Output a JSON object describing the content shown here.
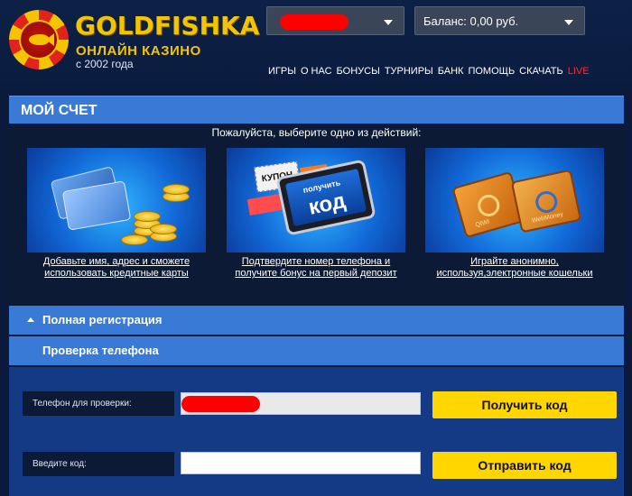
{
  "header": {
    "logo_title": "GOLDFISHKA",
    "logo_subtitle": "ОНЛАЙН КАЗИНО",
    "logo_since": "с 2002 года",
    "user_dropdown_value": "",
    "balance_label": "Баланс: 0,00 руб.",
    "nav": [
      "ИГРЫ",
      "О НАС",
      "БОНУСЫ",
      "ТУРНИРЫ",
      "БАНК",
      "ПОМОЩЬ",
      "СКАЧАТЬ",
      "LIVE"
    ]
  },
  "account": {
    "title": "МОЙ СЧЕТ",
    "prompt": "Пожалуйста, выберите одно из действий:",
    "options": [
      {
        "caption_line1": "Добавьте имя, адрес и сможете",
        "caption_line2": "использовать кредитные карты"
      },
      {
        "caption_line1": "Подтвердите номер телефона и",
        "caption_line2": "получите бонус на первый депозит",
        "art_top": "получить",
        "art_code": "код",
        "art_coupon": "КУПОН"
      },
      {
        "caption_line1": "Играйте анонимно,",
        "caption_line2": "используя,электронные кошельки",
        "art_wallet1": "QIWI",
        "art_wallet2": "WebMoney"
      }
    ]
  },
  "accordion": {
    "full_registration": "Полная регистрация",
    "phone_check": "Проверка телефона"
  },
  "form": {
    "phone_label": "Телефон для проверки:",
    "phone_value": "",
    "get_code_button": "Получить код",
    "code_label": "Введите код:",
    "code_value": "",
    "send_code_button": "Отправить код"
  },
  "colors": {
    "accent_blue": "#3a7ad7",
    "gold": "#f5c400",
    "button_yellow": "#ffd600",
    "live_red": "#ff2a2a",
    "redaction": "#ff0000"
  }
}
